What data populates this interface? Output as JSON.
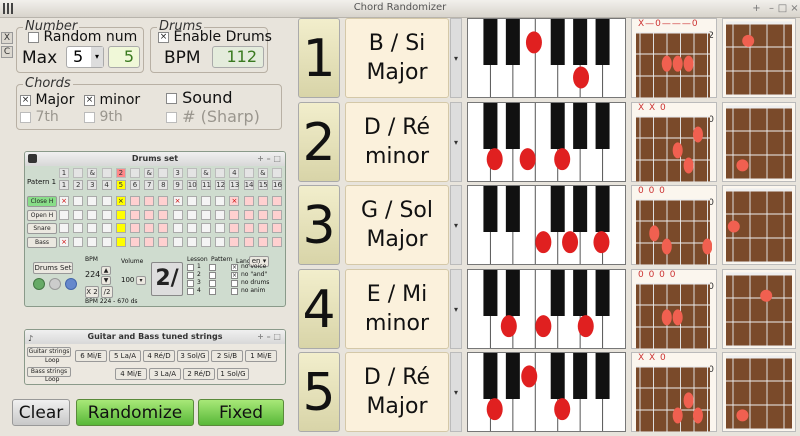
{
  "app": {
    "title": "Chord Randomizer"
  },
  "side": {
    "x": "X",
    "c": "C"
  },
  "number": {
    "label": "Number",
    "random_num": "Random num",
    "random_checked": "",
    "max_label": "Max",
    "max_value": "5",
    "value": "5"
  },
  "drums": {
    "label": "Drums",
    "enable_label": "Enable Drums",
    "enable_checked": "×",
    "bpm_label": "BPM",
    "bpm_value": "112"
  },
  "chords": {
    "label": "Chords",
    "major": "Major",
    "major_checked": "×",
    "minor": "minor",
    "minor_checked": "×",
    "seventh": "7th",
    "ninth": "9th",
    "sound": "Sound",
    "sharp": "# (Sharp)"
  },
  "buttons": {
    "clear": "Clear",
    "randomize": "Randomize",
    "fixed": "Fixed"
  },
  "drumset": {
    "title": "Drums set",
    "patern": "Patern 1",
    "tops": [
      "1",
      "",
      "&",
      "",
      "2",
      "",
      "&",
      "",
      "3",
      "",
      "&",
      "",
      "4",
      "",
      "&",
      ""
    ],
    "steps": [
      "1",
      "2",
      "3",
      "4",
      "5",
      "6",
      "7",
      "8",
      "9",
      "10",
      "11",
      "12",
      "13",
      "14",
      "15",
      "16"
    ],
    "tracks": [
      "Close H",
      "Open H",
      "Snare",
      "Bass"
    ],
    "bpm_label": "BPM",
    "bpm_value": "224",
    "volume_label": "Volume",
    "volume_value": "100",
    "drums_set_btn": "Drums Set",
    "x2": "X 2",
    "div2": "/2",
    "status": "BPM 224 - 670 ds",
    "lesson": "Lesson",
    "pattern": "Pattern",
    "lang": "Lang",
    "lang_value": "en",
    "lesson_nums": [
      "1",
      "2",
      "3",
      "4"
    ],
    "opts": [
      "no voice",
      "no \"and\"",
      "no drums",
      "no anim"
    ],
    "big": "2/"
  },
  "tuned": {
    "title": "Guitar and Bass tuned strings",
    "guitar_label": "Guitar strings",
    "bass_label": "Bass strings",
    "loop": "Loop",
    "guitar": [
      "6 Mi/E",
      "5 La/A",
      "4 Ré/D",
      "3 Sol/G",
      "2 Si/B",
      "1 Mi/E"
    ],
    "bass": [
      "4 Mi/E",
      "3 La/A",
      "2 Ré/D",
      "1 Sol/G"
    ]
  },
  "rows": [
    {
      "num": "1",
      "line1": "B / Si",
      "line2": "Major",
      "piano": [
        [
          0.42,
          0.3
        ],
        [
          0.72,
          0.75
        ]
      ],
      "gtop": "X—0———0——",
      "gfret": "2",
      "gdots": [
        [
          0.42,
          0.48
        ],
        [
          0.56,
          0.48
        ],
        [
          0.7,
          0.48
        ]
      ],
      "bdots": [
        [
          0.35,
          0.28
        ]
      ]
    },
    {
      "num": "2",
      "line1": "D / Ré",
      "line2": "minor",
      "piano": [
        [
          0.17,
          0.72
        ],
        [
          0.38,
          0.72
        ],
        [
          0.6,
          0.72
        ]
      ],
      "gtop": "X X 0",
      "gfret": "0",
      "gdots": [
        [
          0.82,
          0.28
        ],
        [
          0.56,
          0.52
        ],
        [
          0.7,
          0.75
        ]
      ],
      "bdots": [
        [
          0.27,
          0.8
        ]
      ]
    },
    {
      "num": "3",
      "line1": "G / Sol",
      "line2": "Major",
      "piano": [
        [
          0.48,
          0.72
        ],
        [
          0.65,
          0.72
        ],
        [
          0.85,
          0.72
        ]
      ],
      "gtop": "0 0 0",
      "gfret": "0",
      "gdots": [
        [
          0.26,
          0.52
        ],
        [
          0.42,
          0.72
        ],
        [
          0.94,
          0.72
        ]
      ],
      "bdots": [
        [
          0.15,
          0.52
        ]
      ]
    },
    {
      "num": "4",
      "line1": "E / Mi",
      "line2": "minor",
      "piano": [
        [
          0.26,
          0.72
        ],
        [
          0.48,
          0.72
        ],
        [
          0.75,
          0.72
        ]
      ],
      "gtop": "0 0 0 0",
      "gfret": "0",
      "gdots": [
        [
          0.42,
          0.52
        ],
        [
          0.56,
          0.52
        ]
      ],
      "bdots": [
        [
          0.6,
          0.33
        ]
      ]
    },
    {
      "num": "5",
      "line1": "D / Ré",
      "line2": "Major",
      "piano": [
        [
          0.39,
          0.3
        ],
        [
          0.17,
          0.72
        ],
        [
          0.6,
          0.72
        ]
      ],
      "gtop": "X X 0",
      "gfret": "0",
      "gdots": [
        [
          0.7,
          0.52
        ],
        [
          0.56,
          0.75
        ],
        [
          0.82,
          0.75
        ]
      ],
      "bdots": [
        [
          0.27,
          0.8
        ]
      ]
    }
  ]
}
